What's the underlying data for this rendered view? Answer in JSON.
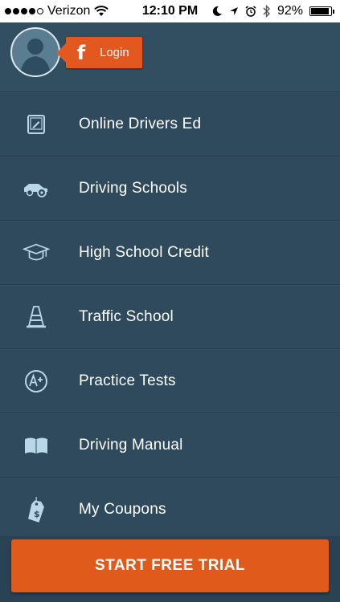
{
  "status_bar": {
    "carrier": "Verizon",
    "time": "12:10 PM",
    "battery": "92%",
    "battery_level": 0.92
  },
  "header": {
    "login_label": "Login",
    "facebook_glyph": "f"
  },
  "menu": {
    "items": [
      {
        "label": "Online Drivers Ed",
        "icon": "tablet-icon"
      },
      {
        "label": "Driving Schools",
        "icon": "car-icon"
      },
      {
        "label": "High School Credit",
        "icon": "graduation-cap-icon"
      },
      {
        "label": "Traffic School",
        "icon": "traffic-cone-icon"
      },
      {
        "label": "Practice Tests",
        "icon": "a-plus-icon"
      },
      {
        "label": "Driving Manual",
        "icon": "book-icon"
      },
      {
        "label": "My Coupons",
        "icon": "price-tag-icon"
      }
    ]
  },
  "cta": {
    "label": "START FREE TRIAL"
  },
  "colors": {
    "background": "#2f4a5c",
    "accent": "#e05a1c",
    "icon": "#b9d7e6"
  }
}
